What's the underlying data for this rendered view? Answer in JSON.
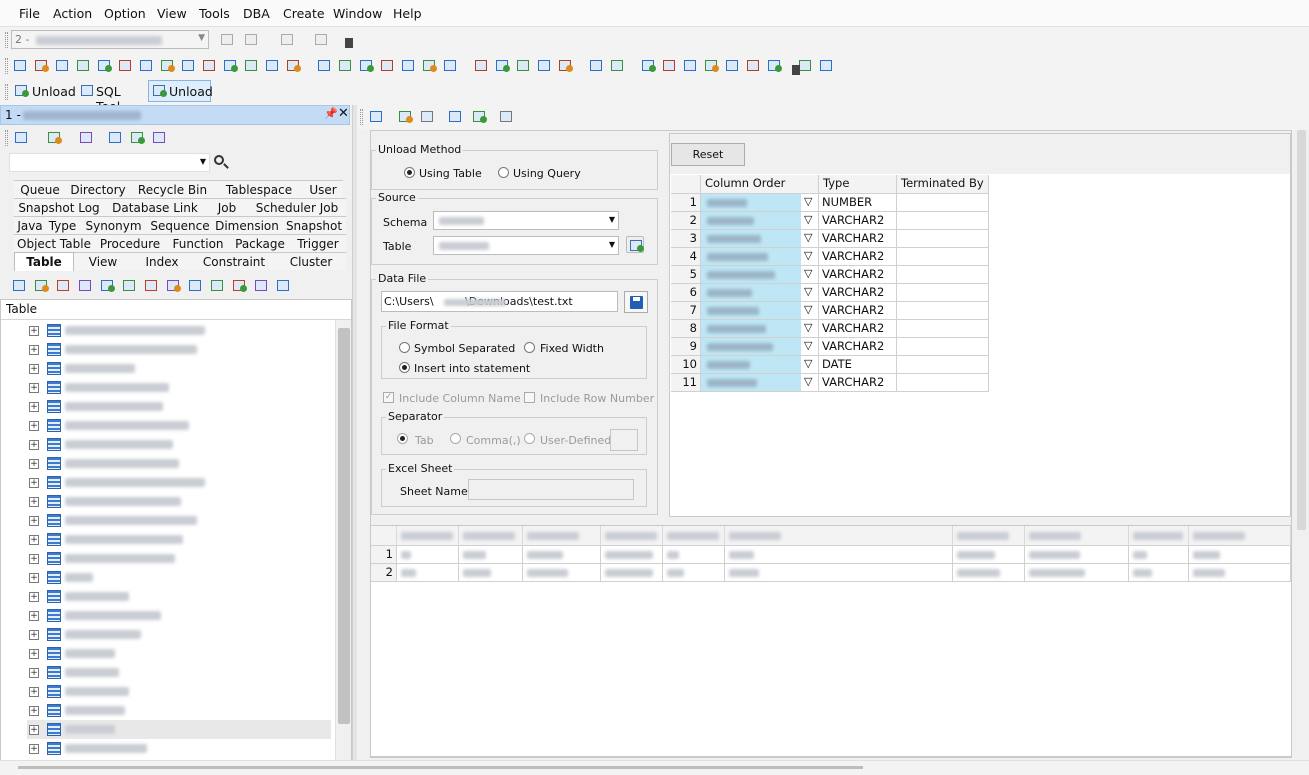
{
  "menu": [
    "File",
    "Action",
    "Option",
    "View",
    "Tools",
    "DBA",
    "Create",
    "Window",
    "Help"
  ],
  "connection": {
    "prefix": "2 -"
  },
  "subtabs": {
    "unload": "Unload",
    "sqltool": "SQL Tool",
    "unload_active": "Unload"
  },
  "panel": {
    "title": "1 -"
  },
  "object_tabs": {
    "row1": [
      "Queue",
      "Directory",
      "Recycle Bin",
      "Tablespace",
      "User"
    ],
    "row2": [
      "Snapshot Log",
      "Database Link",
      "Job",
      "Scheduler Job"
    ],
    "row3": [
      "Java",
      "Type",
      "Synonym",
      "Sequence",
      "Dimension",
      "Snapshot"
    ],
    "row4": [
      "Object Table",
      "Procedure",
      "Function",
      "Package",
      "Trigger"
    ],
    "row5": [
      "Table",
      "View",
      "Index",
      "Constraint",
      "Cluster"
    ]
  },
  "tree": {
    "header": "Table"
  },
  "form": {
    "unload_method": "Unload Method",
    "using_table": "Using Table",
    "using_query": "Using Query",
    "source": "Source",
    "schema": "Schema",
    "table": "Table",
    "data_file": "Data File",
    "file_path": "C:\\Users\\         \\Downloads\\test.txt",
    "file_format": "File Format",
    "symbol_separated": "Symbol Separated",
    "fixed_width": "Fixed Width",
    "insert_into": "Insert into statement",
    "include_column": "Include Column Name",
    "include_row": "Include Row Number",
    "separator": "Separator",
    "tab": "Tab",
    "comma": "Comma(,)",
    "user_defined": "User-Defined",
    "excel_sheet": "Excel Sheet",
    "sheet_name": "Sheet Name"
  },
  "reset_label": "Reset",
  "columns_grid": {
    "headers": [
      "Column Order",
      "Type",
      "Terminated By"
    ],
    "rows": [
      {
        "n": "1",
        "type": "NUMBER"
      },
      {
        "n": "2",
        "type": "VARCHAR2"
      },
      {
        "n": "3",
        "type": "VARCHAR2"
      },
      {
        "n": "4",
        "type": "VARCHAR2"
      },
      {
        "n": "5",
        "type": "VARCHAR2"
      },
      {
        "n": "6",
        "type": "VARCHAR2"
      },
      {
        "n": "7",
        "type": "VARCHAR2"
      },
      {
        "n": "8",
        "type": "VARCHAR2"
      },
      {
        "n": "9",
        "type": "VARCHAR2"
      },
      {
        "n": "10",
        "type": "DATE"
      },
      {
        "n": "11",
        "type": "VARCHAR2"
      }
    ],
    "sort_glyph": "▽"
  },
  "preview": {
    "rows": [
      "1",
      "2"
    ]
  }
}
